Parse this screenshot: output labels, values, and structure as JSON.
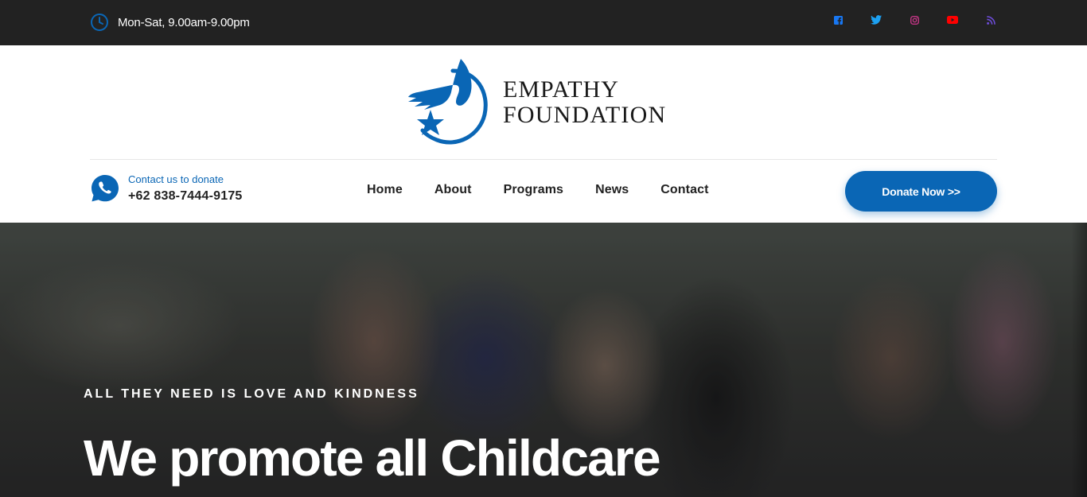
{
  "topbar": {
    "hours": "Mon-Sat, 9.00am-9.00pm",
    "socials": [
      {
        "icon": "facebook-icon",
        "color": "#1877f2"
      },
      {
        "icon": "twitter-icon",
        "color": "#1da1f2"
      },
      {
        "icon": "instagram-icon",
        "color": "#c13584"
      },
      {
        "icon": "youtube-icon",
        "color": "#ff0000"
      },
      {
        "icon": "rss-icon",
        "color": "#6c4cd6"
      }
    ]
  },
  "brand": {
    "line1": "EMPATHY",
    "line2": "FOUNDATION",
    "color": "#0a66b5"
  },
  "contact": {
    "label": "Contact us to donate",
    "phone": "+62 838-7444-9175"
  },
  "nav": {
    "items": [
      "Home",
      "About",
      "Programs",
      "News",
      "Contact"
    ]
  },
  "donate_button": {
    "label": "Donate Now >>"
  },
  "hero": {
    "tagline": "ALL THEY NEED IS LOVE AND KINDNESS",
    "headline": "We promote all Childcare"
  }
}
